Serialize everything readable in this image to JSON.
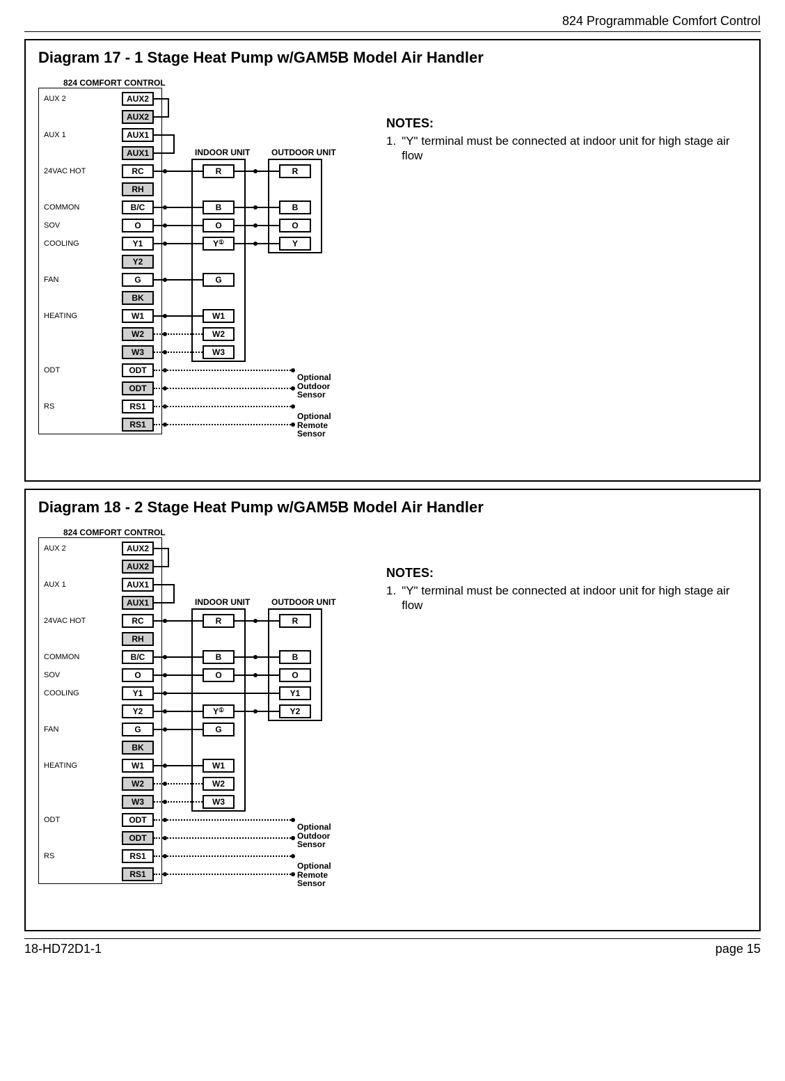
{
  "header": {
    "title": "824 Programmable Comfort Control"
  },
  "footer": {
    "left": "18-HD72D1-1",
    "right": "page 15"
  },
  "diagram17": {
    "title": "Diagram 17 - 1 Stage Heat Pump w/GAM5B Model Air Handler",
    "ctrl_header": "824 COMFORT CONTROL",
    "indoor_label": "INDOOR UNIT",
    "outdoor_label": "OUTDOOR UNIT",
    "labels": {
      "aux2": "AUX 2",
      "aux1": "AUX 1",
      "hot": "24VAC HOT",
      "common": "COMMON",
      "sov": "SOV",
      "cooling": "COOLING",
      "fan": "FAN",
      "heating": "HEATING",
      "odt": "ODT",
      "rs": "RS"
    },
    "ctrl_terms": [
      "AUX2",
      "AUX2",
      "AUX1",
      "AUX1",
      "RC",
      "RH",
      "B/C",
      "O",
      "Y1",
      "Y2",
      "G",
      "BK",
      "W1",
      "W2",
      "W3",
      "ODT",
      "ODT",
      "RS1",
      "RS1"
    ],
    "indoor_terms": {
      "r": "R",
      "b": "B",
      "o": "O",
      "y": "Y",
      "g": "G",
      "w1": "W1",
      "w2": "W2",
      "w3": "W3"
    },
    "outdoor_terms": {
      "r": "R",
      "b": "B",
      "o": "O",
      "y": "Y"
    },
    "y_note_marker": "①",
    "sensors": {
      "outdoor": "Optional\nOutdoor\nSensor",
      "remote": "Optional\nRemote\nSensor"
    },
    "notes": {
      "title": "NOTES:",
      "items": [
        {
          "n": "1.",
          "t": "\"Y\" terminal must be connected at indoor unit for high stage air flow"
        }
      ]
    }
  },
  "diagram18": {
    "title": "Diagram 18 - 2 Stage Heat Pump w/GAM5B Model Air Handler",
    "ctrl_header": "824 COMFORT CONTROL",
    "indoor_label": "INDOOR UNIT",
    "outdoor_label": "OUTDOOR UNIT",
    "labels": {
      "aux2": "AUX 2",
      "aux1": "AUX 1",
      "hot": "24VAC HOT",
      "common": "COMMON",
      "sov": "SOV",
      "cooling": "COOLING",
      "fan": "FAN",
      "heating": "HEATING",
      "odt": "ODT",
      "rs": "RS"
    },
    "ctrl_terms": [
      "AUX2",
      "AUX2",
      "AUX1",
      "AUX1",
      "RC",
      "RH",
      "B/C",
      "O",
      "Y1",
      "Y2",
      "G",
      "BK",
      "W1",
      "W2",
      "W3",
      "ODT",
      "ODT",
      "RS1",
      "RS1"
    ],
    "indoor_terms": {
      "r": "R",
      "b": "B",
      "o": "O",
      "y": "Y",
      "g": "G",
      "w1": "W1",
      "w2": "W2",
      "w3": "W3"
    },
    "outdoor_terms": {
      "r": "R",
      "b": "B",
      "o": "O",
      "y1": "Y1",
      "y2": "Y2"
    },
    "y_note_marker": "①",
    "sensors": {
      "outdoor": "Optional\nOutdoor\nSensor",
      "remote": "Optional\nRemote\nSensor"
    },
    "notes": {
      "title": "NOTES:",
      "items": [
        {
          "n": "1.",
          "t": "\"Y\" terminal must be connected at indoor unit for high stage air flow"
        }
      ]
    }
  }
}
